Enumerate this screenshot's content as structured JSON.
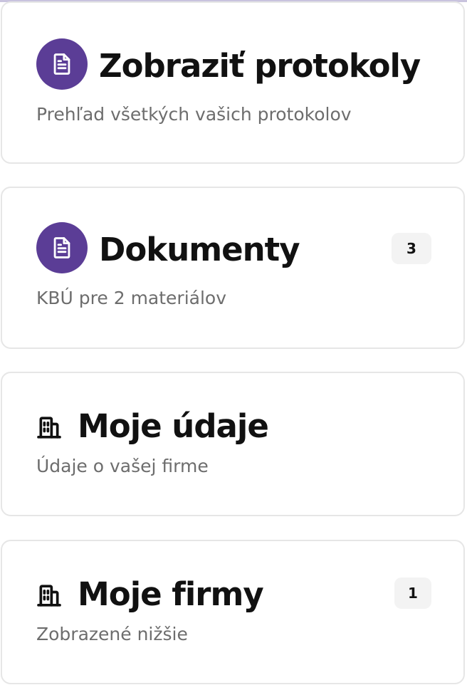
{
  "cards": [
    {
      "title": "Zobraziť protokoly",
      "subtitle": "Prehľad všetkých vašich protokolov",
      "icon": "document-icon"
    },
    {
      "title": "Dokumenty",
      "subtitle": "KBÚ pre 2 materiálov",
      "badge": "3",
      "icon": "document-icon"
    },
    {
      "title": "Moje údaje",
      "subtitle": "Údaje o vašej firme",
      "icon": "building-icon"
    },
    {
      "title": "Moje firmy",
      "subtitle": "Zobrazené nižšie",
      "badge": "1",
      "icon": "building-icon"
    }
  ],
  "colors": {
    "accent": "#5b3d96",
    "title_text": "#111111",
    "subtitle_text": "#6d6d6d",
    "border": "#e6e6e6",
    "badge_bg": "#f3f3f3"
  }
}
